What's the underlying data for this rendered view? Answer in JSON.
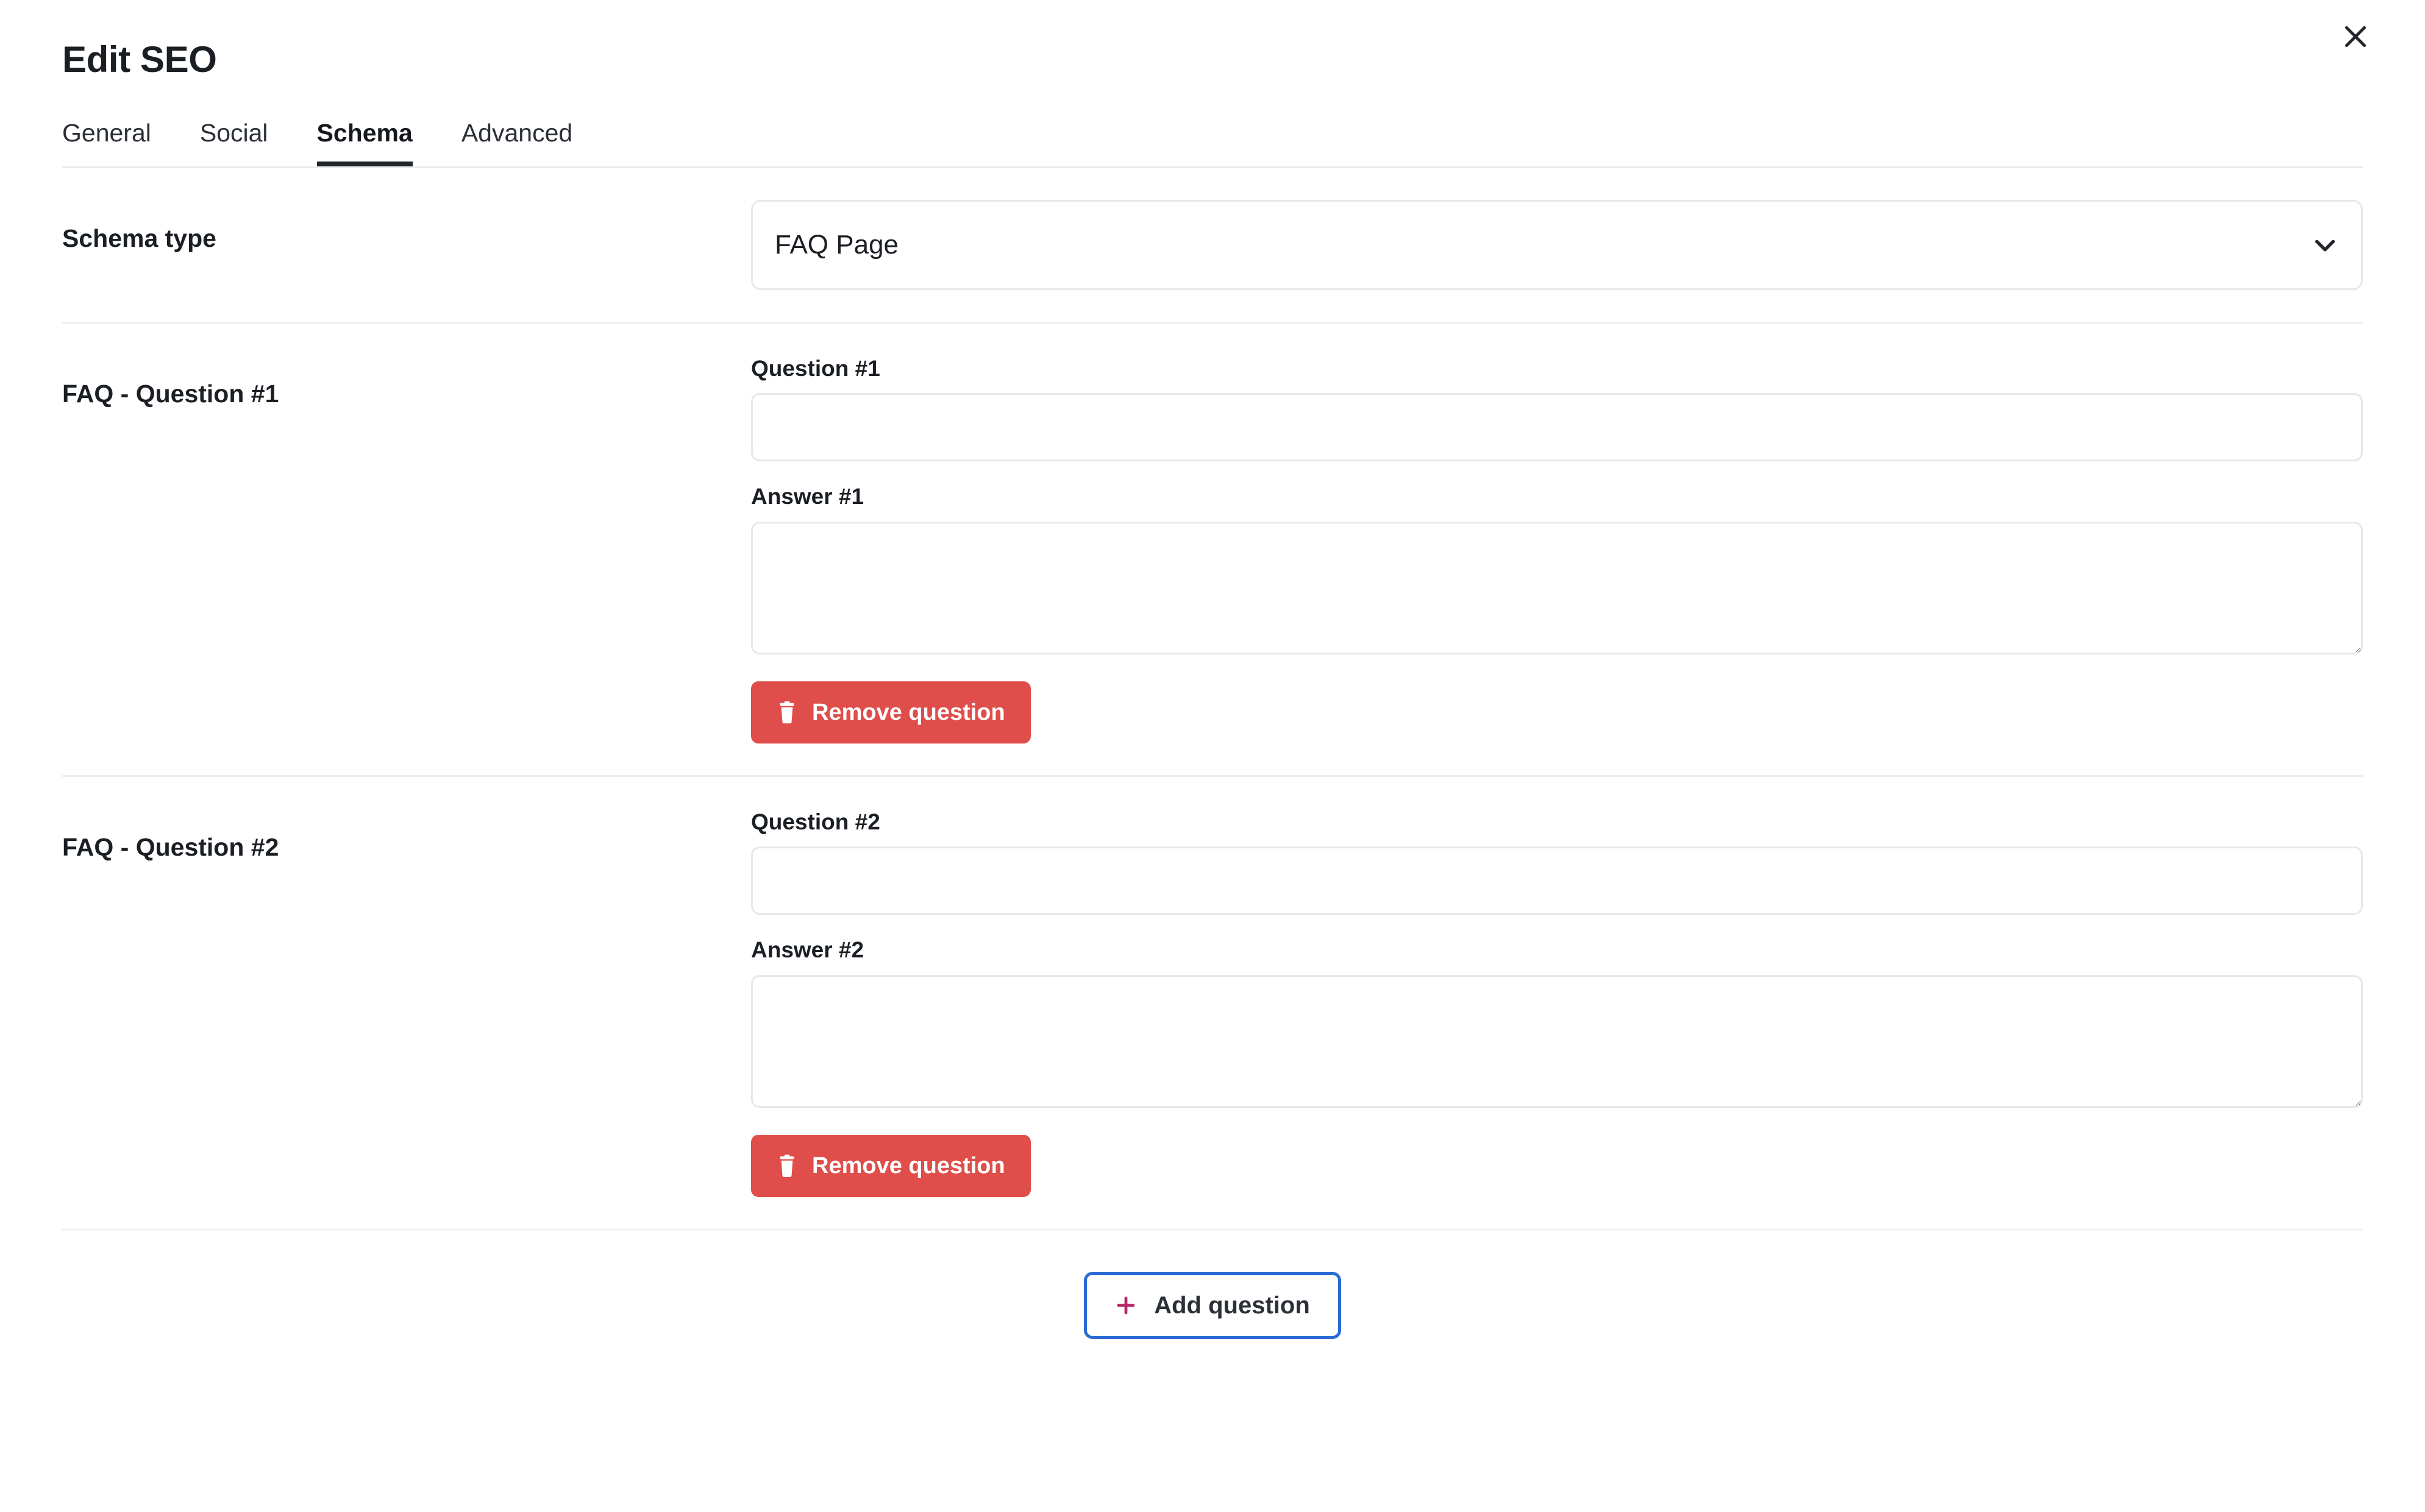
{
  "modal": {
    "title": "Edit SEO",
    "close_icon": "close-icon"
  },
  "tabs": [
    {
      "label": "General",
      "active": false
    },
    {
      "label": "Social",
      "active": false
    },
    {
      "label": "Schema",
      "active": true
    },
    {
      "label": "Advanced",
      "active": false
    }
  ],
  "schema_type": {
    "label": "Schema type",
    "selected": "FAQ Page",
    "chevron_icon": "chevron-down-icon"
  },
  "faq_questions": [
    {
      "section_label": "FAQ - Question #1",
      "question_label": "Question #1",
      "question_value": "",
      "answer_label": "Answer #1",
      "answer_value": "",
      "remove_label": "Remove question",
      "remove_icon": "trash-icon"
    },
    {
      "section_label": "FAQ - Question #2",
      "question_label": "Question #2",
      "question_value": "",
      "answer_label": "Answer #2",
      "answer_value": "",
      "remove_label": "Remove question",
      "remove_icon": "trash-icon"
    }
  ],
  "footer": {
    "add_label": "Add question",
    "add_icon": "plus-icon"
  },
  "colors": {
    "danger": "#df4e4a",
    "accent_border": "#2b6cd4",
    "plus": "#b5276a",
    "active_tab_underline": "#212529",
    "border": "#e6e8ea",
    "divider": "#eceef0",
    "text": "#1b1f24"
  }
}
